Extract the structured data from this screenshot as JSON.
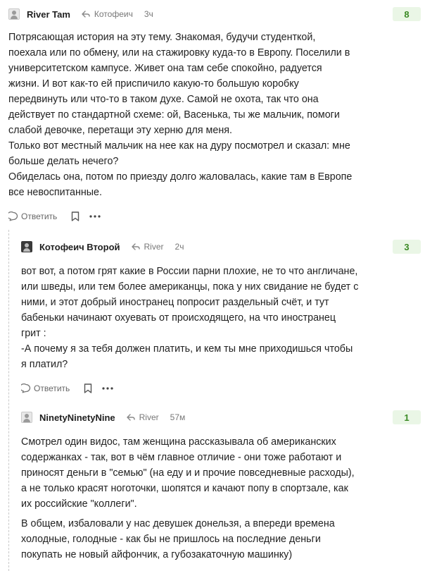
{
  "comments": [
    {
      "author": "River Tam",
      "reply_to": "Котофеич",
      "time": "3ч",
      "rating": "8",
      "lines": [
        "Потрясающая история на эту тему. Знакомая, будучи студенткой,",
        "поехала или по обмену, или на стажировку куда-то в Европу. Поселили в",
        "университетском кампусе. Живет она там себе спокойно, радуется",
        "жизни. И вот как-то ей приспичило какую-то большую коробку",
        "передвинуть или что-то в таком духе. Самой не охота, так что она",
        "действует по стандартной схеме: ой, Васенька, ты же мальчик, помоги",
        "слабой девочке, перетащи эту херню для меня.",
        "Только вот местный мальчик на нее как на дуру посмотрел и сказал: мне",
        "больше делать нечего?",
        "Обиделась она, потом по приезду долго жаловалась, какие там в Европе",
        "все невоспитанные."
      ],
      "reply_label": "Ответить"
    },
    {
      "author": "Котофеич Второй",
      "reply_to": "River",
      "time": "2ч",
      "rating": "3",
      "lines": [
        "вот вот, а потом грят какие в России парни плохие, не то что англичане,",
        "или шведы, или тем более американцы, пока у них свидание не будет с",
        "ними, и этот добрый иностранец попросит раздельный счёт, и тут",
        "бабеньки начинают охуевать от происходящего, на что иностранец",
        "грит :",
        "-А почему я за тебя должен платить, и кем ты мне приходишься чтобы",
        "я платил?"
      ],
      "reply_label": "Ответить"
    },
    {
      "author": "NinetyNinetyNine",
      "reply_to": "River",
      "time": "57м",
      "rating": "1",
      "paragraph1": [
        "Смотрел один видос, там женщина рассказывала об американских",
        "содержанках - так, вот в чём главное отличие - они тоже работают и",
        "приносят деньги в \"семью\" (на еду и и прочие повседневные расходы),",
        "а не только красят ноготочки, шопятся и качают попу в спортзале, как",
        "их российские \"коллеги\"."
      ],
      "paragraph2": [
        "В общем, избаловали у нас девушек донельзя, а впереди времена",
        "холодные, голодные - как бы не пришлось на последние деньги",
        "покупать не новый айфончик, а губозакаточную машинку)"
      ]
    }
  ],
  "colors": {
    "rating_bg": "#eaf6e6",
    "rating_text": "#3b8a25",
    "meta_text": "#777777"
  },
  "icons": {
    "reply_arrow": "reply-arrow-icon",
    "reply_bubble": "comment-bubble-icon",
    "bookmark": "bookmark-icon",
    "more": "more-dots-icon"
  }
}
